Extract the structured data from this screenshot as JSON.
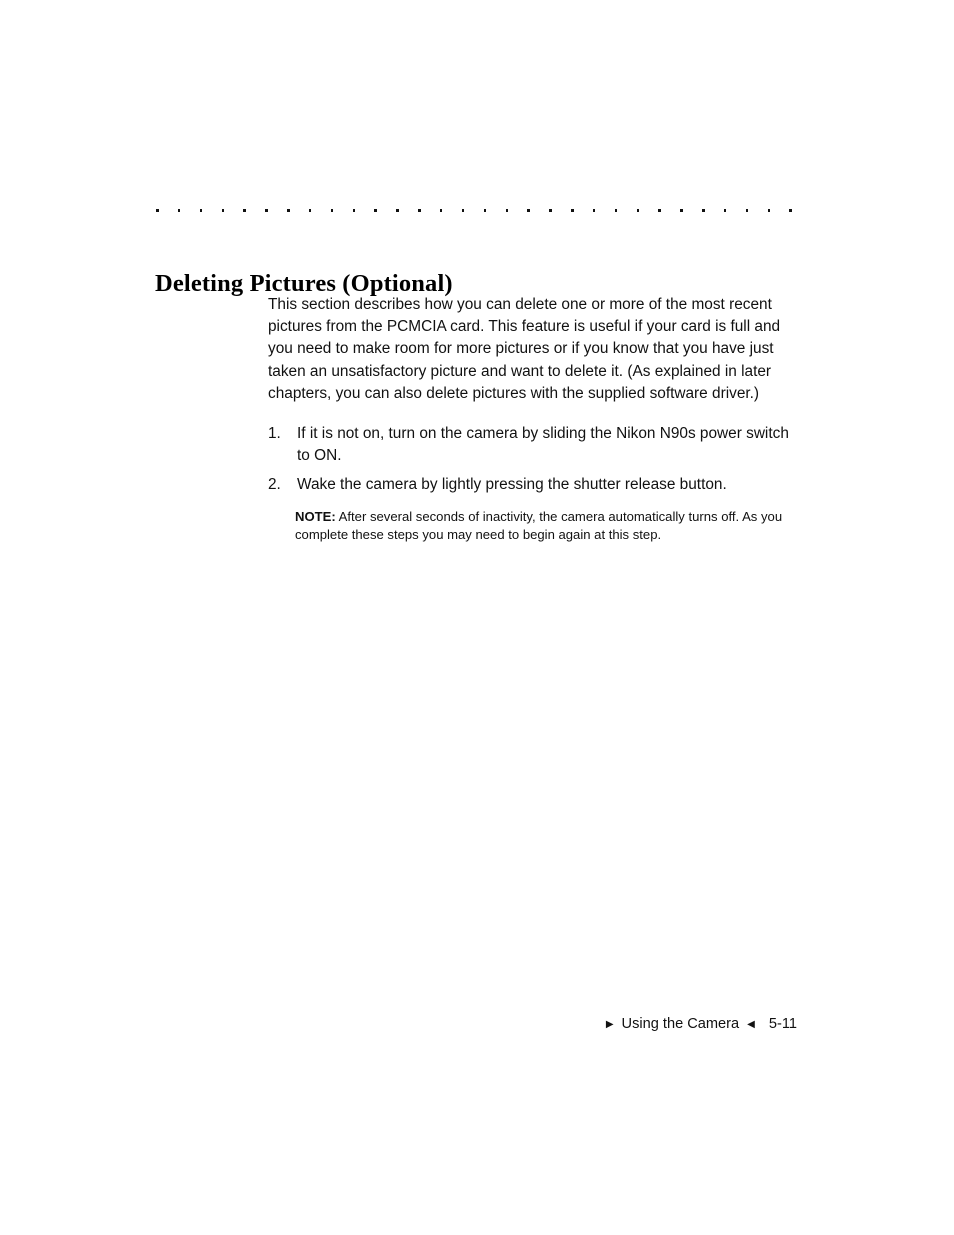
{
  "page": {
    "heading": "Deleting Pictures (Optional)",
    "rule": {
      "icon": "dotted-rule",
      "dot_count": 30
    }
  },
  "content": {
    "intro": "This section describes how you can delete one or more of the most recent pictures from the PCMCIA card. This feature is useful if your card is full and you need to make room for more pictures or if you know that you have just taken an unsatisfactory picture and want to delete it. (As explained in later chapters, you can also delete pictures with the supplied software driver.)",
    "steps": [
      {
        "number": "1.",
        "text": "If it is not on, turn on the camera by sliding the Nikon N90s power switch to ON."
      },
      {
        "number": "2.",
        "text": "Wake the camera by lightly pressing the shutter release button."
      }
    ],
    "note": {
      "label": "NOTE:",
      "text": " After several seconds of inactivity, the camera automatically turns off. As you complete these steps you may need to begin again at this step."
    }
  },
  "footer": {
    "left_marker": "▶",
    "chapter": "Using the Camera",
    "right_marker": "◀",
    "page_number": "5-11"
  }
}
